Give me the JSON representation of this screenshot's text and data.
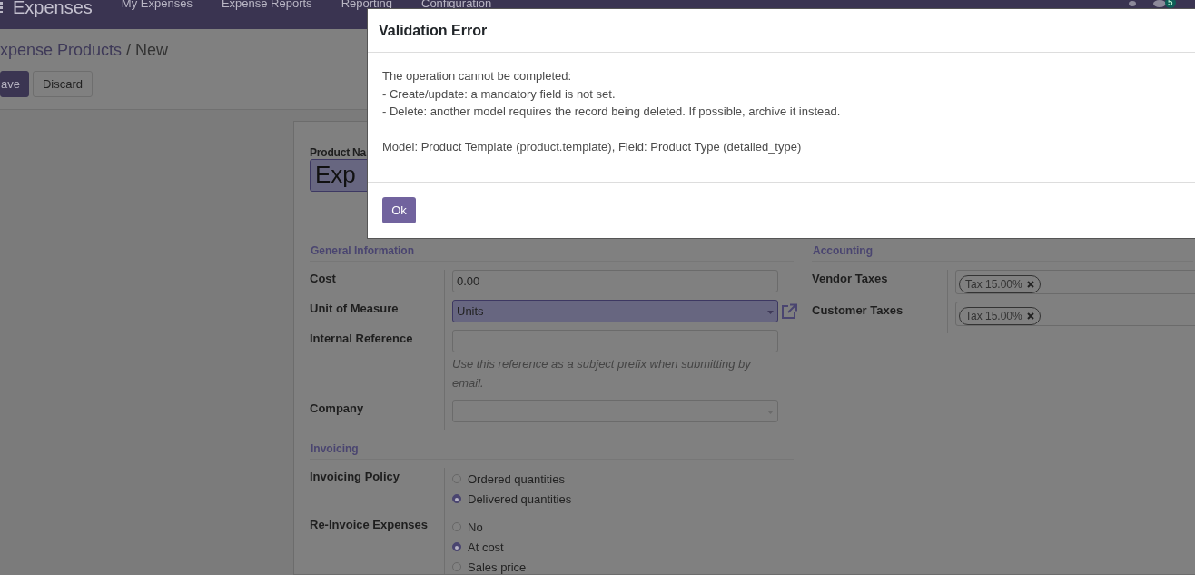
{
  "navbar": {
    "app_name": "Expenses",
    "menu": [
      {
        "label": "My Expenses"
      },
      {
        "label": "Expense Reports"
      },
      {
        "label": "Reporting"
      },
      {
        "label": "Configuration"
      }
    ],
    "badge": "5"
  },
  "breadcrumb": {
    "parent": "xpense Products",
    "separator": "/",
    "current": "New"
  },
  "buttons": [
    {
      "label": "ave",
      "kind": "primary"
    },
    {
      "label": "Discard",
      "kind": "secondary"
    }
  ],
  "form": {
    "name_label": "Product Na",
    "name_value": "Exp",
    "left_groups": [
      {
        "title": "General Information",
        "fields": [
          {
            "label": "Cost",
            "kind": "text",
            "value": "0.00",
            "required": false
          },
          {
            "label": "Unit of Measure",
            "kind": "select",
            "value": "Units",
            "required": true,
            "external_link": true
          },
          {
            "label": "Internal Reference",
            "kind": "text",
            "required": false,
            "help": "Use this reference as a subject prefix when submitting by email."
          },
          {
            "label": "Company",
            "kind": "select",
            "required": false
          }
        ]
      },
      {
        "title": "Invoicing",
        "fields": [
          {
            "label": "Invoicing Policy",
            "kind": "radio",
            "options": [
              {
                "label": "Ordered quantities",
                "selected": false
              },
              {
                "label": "Delivered quantities",
                "selected": true
              }
            ]
          },
          {
            "label": "Re-Invoice Expenses",
            "kind": "radio",
            "options": [
              {
                "label": "No",
                "selected": false
              },
              {
                "label": "At cost",
                "selected": true
              },
              {
                "label": "Sales price",
                "selected": false
              }
            ]
          }
        ]
      }
    ],
    "right_groups": [
      {
        "title": "Accounting",
        "fields": [
          {
            "label": "Vendor Taxes",
            "kind": "tags",
            "tags": [
              "Tax 15.00%"
            ]
          },
          {
            "label": "Customer Taxes",
            "kind": "tags",
            "tags": [
              "Tax 15.00%"
            ]
          }
        ]
      }
    ]
  },
  "dialog": {
    "title": "Validation Error",
    "message_lines": [
      "The operation cannot be completed:",
      "- Create/update: a mandatory field is not set.",
      "- Delete: another model requires the record being deleted. If possible, archive it instead."
    ],
    "detail": "Model: Product Template (product.template), Field: Product Type (detailed_type)",
    "button": "Ok"
  }
}
